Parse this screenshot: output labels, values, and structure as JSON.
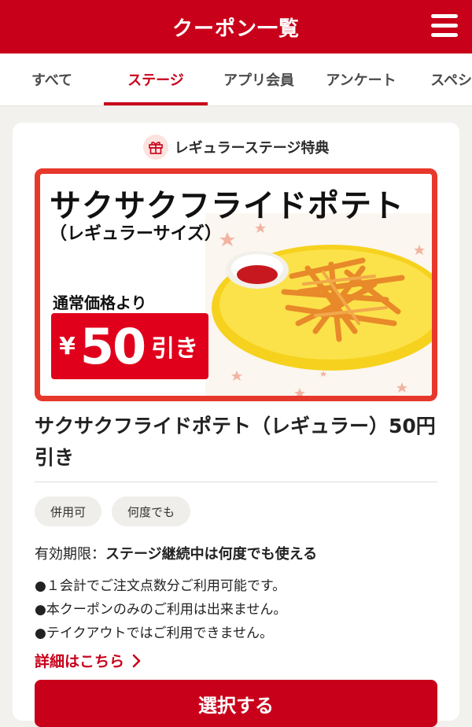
{
  "header": {
    "title": "クーポン一覧",
    "menu_icon": "hamburger-menu-icon"
  },
  "tabs": [
    {
      "label": "すべて",
      "active": false
    },
    {
      "label": "ステージ",
      "active": true
    },
    {
      "label": "アプリ会員",
      "active": false
    },
    {
      "label": "アンケート",
      "active": false
    },
    {
      "label": "スペシ",
      "active": false
    }
  ],
  "coupon": {
    "badge": {
      "icon": "gift-icon",
      "label": "レギュラーステージ特典"
    },
    "image": {
      "title": "サクサクフライドポテト",
      "subtitle": "（レギュラーサイズ）",
      "normal_price": "通常価格より",
      "yen": "¥",
      "amount": "50",
      "discount_suffix": "引き"
    },
    "title": "サクサクフライドポテト（レギュラー）50円引き",
    "tags": [
      "併用可",
      "何度でも"
    ],
    "validity_label": "有効期限：",
    "validity_value": "ステージ継続中は何度でも使える",
    "notes": [
      "●１会計でご注文点数分ご利用可能です。",
      "●本クーポンのみのご利用は出来ません。",
      "●テイクアウトではご利用できません。"
    ],
    "details_link": "詳細はこちら",
    "select_button": "選択する"
  },
  "colors": {
    "brand_red": "#c8001a",
    "coupon_border": "#e7382c",
    "price_red": "#e0001b"
  }
}
